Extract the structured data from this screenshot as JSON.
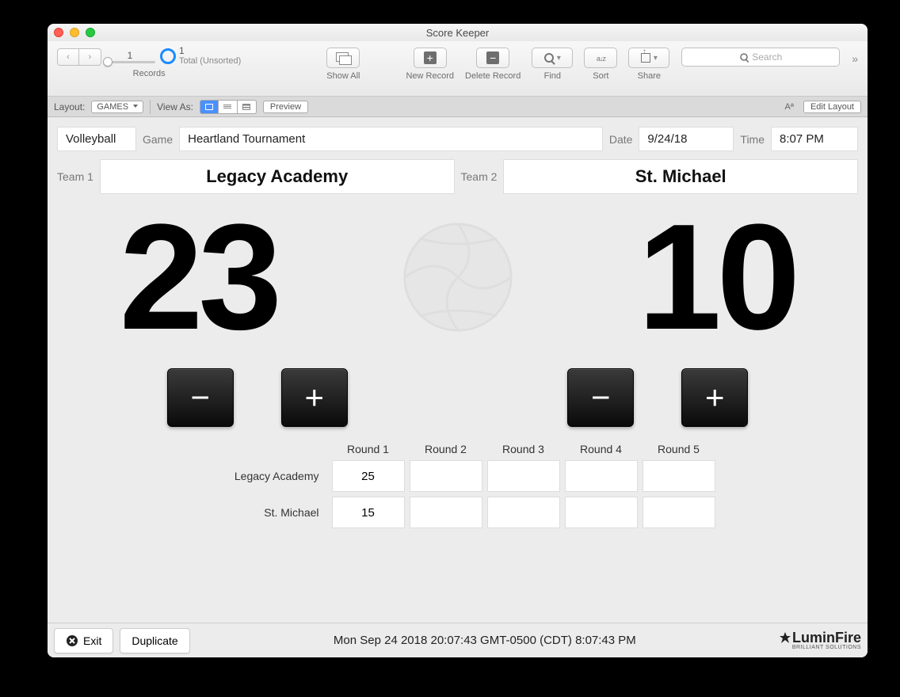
{
  "window": {
    "title": "Score Keeper"
  },
  "toolbar": {
    "records_label": "Records",
    "record_num": "1",
    "record_total": "1",
    "record_status": "Total (Unsorted)",
    "show_all": "Show All",
    "new_record": "New Record",
    "delete_record": "Delete Record",
    "find": "Find",
    "sort": "Sort",
    "share": "Share",
    "search_placeholder": "Search"
  },
  "layoutbar": {
    "layout_label": "Layout:",
    "layout_value": "GAMES",
    "viewas_label": "View As:",
    "preview": "Preview",
    "edit_layout": "Edit Layout",
    "aa": "Aª"
  },
  "game": {
    "sport": "Volleyball",
    "game_label": "Game",
    "game_name": "Heartland Tournament",
    "date_label": "Date",
    "date_value": "9/24/18",
    "time_label": "Time",
    "time_value": "8:07 PM"
  },
  "teams": {
    "team1_label": "Team 1",
    "team1_name": "Legacy Academy",
    "team2_label": "Team 2",
    "team2_name": "St. Michael"
  },
  "scores": {
    "team1": "23",
    "team2": "10"
  },
  "rounds": {
    "headers": [
      "Round 1",
      "Round 2",
      "Round 3",
      "Round 4",
      "Round 5"
    ],
    "rows": [
      {
        "label": "Legacy Academy",
        "cells": [
          "25",
          "",
          "",
          "",
          ""
        ]
      },
      {
        "label": "St. Michael",
        "cells": [
          "15",
          "",
          "",
          "",
          ""
        ]
      }
    ]
  },
  "bottom": {
    "exit": "Exit",
    "duplicate": "Duplicate",
    "timestamp": "Mon Sep 24 2018 20:07:43 GMT-0500 (CDT) 8:07:43 PM",
    "brand": "LuminFire",
    "brand_sub": "BRILLIANT SOLUTIONS"
  }
}
